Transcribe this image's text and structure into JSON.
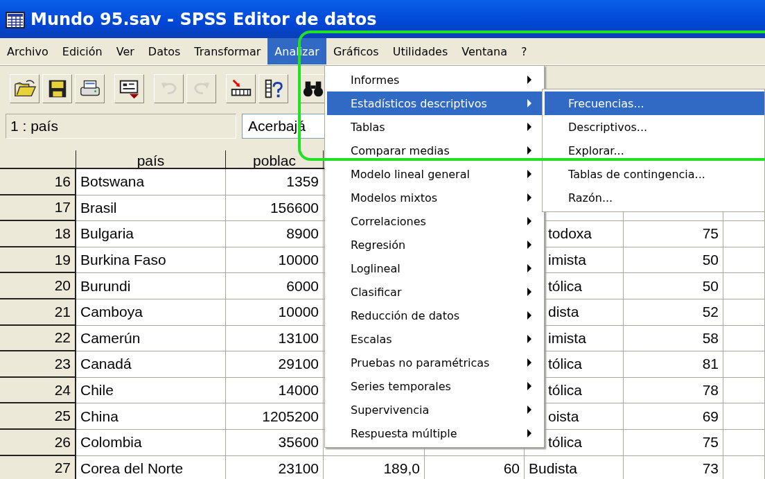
{
  "window": {
    "title": "Mundo 95.sav - SPSS Editor de datos"
  },
  "menu_bar": [
    {
      "label": "Archivo",
      "selected": false
    },
    {
      "label": "Edición",
      "selected": false
    },
    {
      "label": "Ver",
      "selected": false
    },
    {
      "label": "Datos",
      "selected": false
    },
    {
      "label": "Transformar",
      "selected": false
    },
    {
      "label": "Analizar",
      "selected": true
    },
    {
      "label": "Gráficos",
      "selected": false
    },
    {
      "label": "Utilidades",
      "selected": false
    },
    {
      "label": "Ventana",
      "selected": false
    },
    {
      "label": "?",
      "selected": false
    }
  ],
  "toolbar": [
    {
      "kind": "open",
      "disabled": false
    },
    {
      "kind": "save",
      "disabled": false
    },
    {
      "kind": "print",
      "disabled": false
    },
    {
      "kind": "dialog",
      "disabled": false
    },
    {
      "kind": "undo",
      "disabled": true
    },
    {
      "kind": "redo",
      "disabled": true
    },
    {
      "kind": "goto",
      "disabled": false
    },
    {
      "kind": "variables",
      "disabled": false
    },
    {
      "kind": "find",
      "disabled": false
    }
  ],
  "cell_editor": {
    "cell_reference": "1 : país",
    "value": "Acerbajá"
  },
  "table": {
    "columns": [
      "país",
      "poblac"
    ],
    "rows": [
      {
        "number": "16",
        "pais": "Botswana",
        "poblacion": "1359"
      },
      {
        "number": "17",
        "pais": "Brasil",
        "poblacion": "156600"
      },
      {
        "number": "18",
        "pais": "Bulgaria",
        "poblacion": "8900",
        "column_5": "todoxa",
        "column_6": "75",
        "covered": true
      },
      {
        "number": "19",
        "pais": "Burkina Faso",
        "poblacion": "10000",
        "column_5": "imista",
        "column_6": "50",
        "covered": true
      },
      {
        "number": "20",
        "pais": "Burundi",
        "poblacion": "6000",
        "column_5": "tólica",
        "column_6": "50",
        "covered": true
      },
      {
        "number": "21",
        "pais": "Camboya",
        "poblacion": "10000",
        "column_5": "dista",
        "column_6": "52",
        "covered": true
      },
      {
        "number": "22",
        "pais": "Camerún",
        "poblacion": "13100",
        "column_5": "imista",
        "column_6": "58",
        "covered": true
      },
      {
        "number": "23",
        "pais": "Canadá",
        "poblacion": "29100",
        "column_5": "tólica",
        "column_6": "81",
        "covered": true
      },
      {
        "number": "24",
        "pais": "Chile",
        "poblacion": "14000",
        "column_5": "tólica",
        "column_6": "78",
        "covered": true
      },
      {
        "number": "25",
        "pais": "China",
        "poblacion": "1205200",
        "column_5": "oista",
        "column_6": "69",
        "covered": true
      },
      {
        "number": "26",
        "pais": "Colombia",
        "poblacion": "35600",
        "column_5": "tólica",
        "column_6": "75",
        "covered": true
      },
      {
        "number": "27",
        "pais": "Corea del Norte",
        "poblacion": "23100",
        "column_3": "189,0",
        "column_4": "60",
        "column_5": "Budista",
        "column_6": "73",
        "covered": false
      }
    ]
  },
  "analyze_menu": [
    {
      "label": "Informes",
      "selected": false
    },
    {
      "label": "Estadísticos descriptivos",
      "selected": true
    },
    {
      "label": "Tablas",
      "selected": false
    },
    {
      "label": "Comparar medias",
      "selected": false
    },
    {
      "label": "Modelo lineal general",
      "selected": false
    },
    {
      "label": "Modelos mixtos",
      "selected": false
    },
    {
      "label": "Correlaciones",
      "selected": false
    },
    {
      "label": "Regresión",
      "selected": false
    },
    {
      "label": "Loglineal",
      "selected": false
    },
    {
      "label": "Clasificar",
      "selected": false
    },
    {
      "label": "Reducción de datos",
      "selected": false
    },
    {
      "label": "Escalas",
      "selected": false
    },
    {
      "label": "Pruebas no paramétricas",
      "selected": false
    },
    {
      "label": "Series temporales",
      "selected": false
    },
    {
      "label": "Supervivencia",
      "selected": false
    },
    {
      "label": "Respuesta múltiple",
      "selected": false
    }
  ],
  "submenu": [
    {
      "label": "Frecuencias...",
      "selected": true
    },
    {
      "label": "Descriptivos...",
      "selected": false
    },
    {
      "label": "Explorar...",
      "selected": false
    },
    {
      "label": "Tablas de contingencia...",
      "selected": false
    },
    {
      "label": "Razón...",
      "selected": false
    }
  ]
}
